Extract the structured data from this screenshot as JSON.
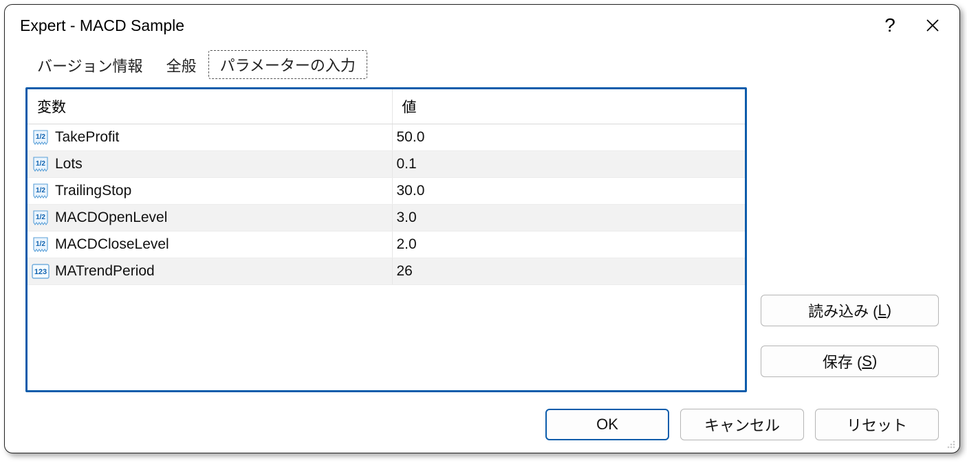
{
  "title": "Expert - MACD Sample",
  "tabs": {
    "version": "バージョン情報",
    "general": "全般",
    "params": "パラメーターの入力"
  },
  "table": {
    "col_variable": "変数",
    "col_value": "値",
    "rows": [
      {
        "icon": "double",
        "name": "TakeProfit",
        "value": "50.0"
      },
      {
        "icon": "double",
        "name": "Lots",
        "value": "0.1"
      },
      {
        "icon": "double",
        "name": "TrailingStop",
        "value": "30.0"
      },
      {
        "icon": "double",
        "name": "MACDOpenLevel",
        "value": "3.0"
      },
      {
        "icon": "double",
        "name": "MACDCloseLevel",
        "value": "2.0"
      },
      {
        "icon": "int",
        "name": "MATrendPeriod",
        "value": "26"
      }
    ]
  },
  "buttons": {
    "load_prefix": "読み込み (",
    "load_key": "L",
    "load_suffix": ")",
    "save_prefix": "保存 (",
    "save_key": "S",
    "save_suffix": ")",
    "ok": "OK",
    "cancel": "キャンセル",
    "reset": "リセット"
  }
}
